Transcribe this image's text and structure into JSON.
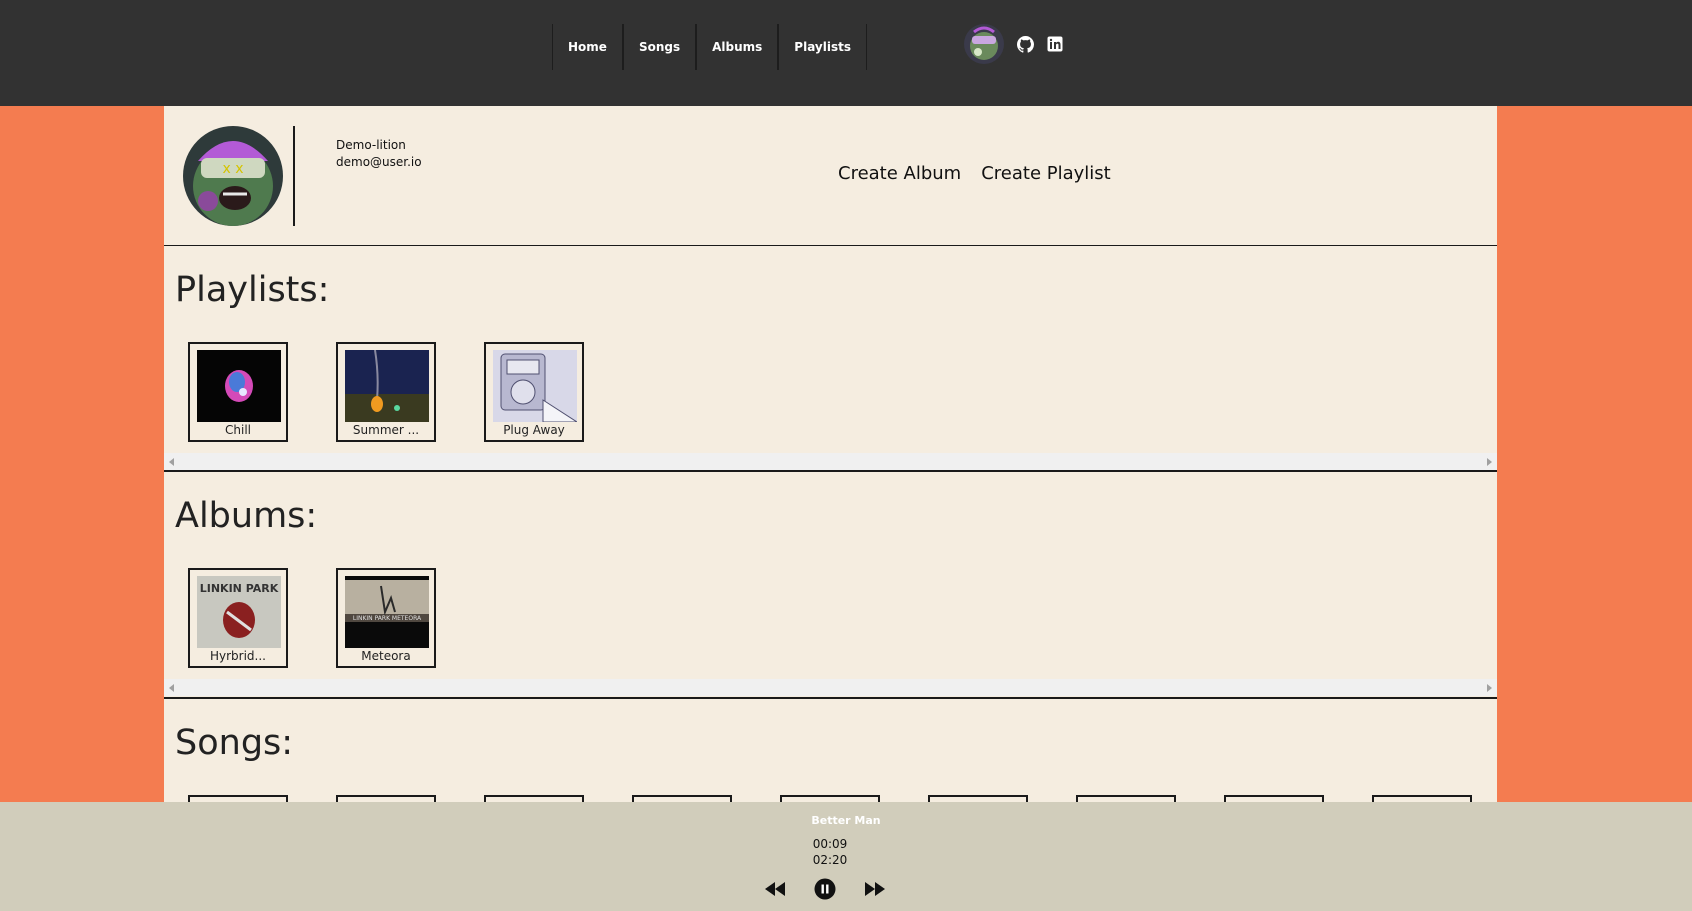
{
  "nav": {
    "items": [
      {
        "label": "Home"
      },
      {
        "label": "Songs"
      },
      {
        "label": "Albums"
      },
      {
        "label": "Playlists"
      }
    ],
    "icons": [
      "avatar",
      "github-icon",
      "linkedin-icon"
    ]
  },
  "profile": {
    "name": "Demo-lition",
    "email": "demo@user.io",
    "create_album": "Create Album",
    "create_playlist": "Create Playlist"
  },
  "playlists": {
    "title": "Playlists:",
    "items": [
      {
        "label": "Chill"
      },
      {
        "label": "Summer ..."
      },
      {
        "label": "Plug Away"
      }
    ]
  },
  "albums": {
    "title": "Albums:",
    "items": [
      {
        "label": "Hyrbrid..."
      },
      {
        "label": "Meteora"
      }
    ]
  },
  "songs": {
    "title": "Songs:"
  },
  "player": {
    "song_title": "Better Man",
    "current_time": "00:09",
    "duration": "02:20"
  },
  "colors": {
    "background": "#f47c50",
    "topbar": "#323232",
    "panel": "#f5ede0",
    "player": "#d1cdbb"
  }
}
